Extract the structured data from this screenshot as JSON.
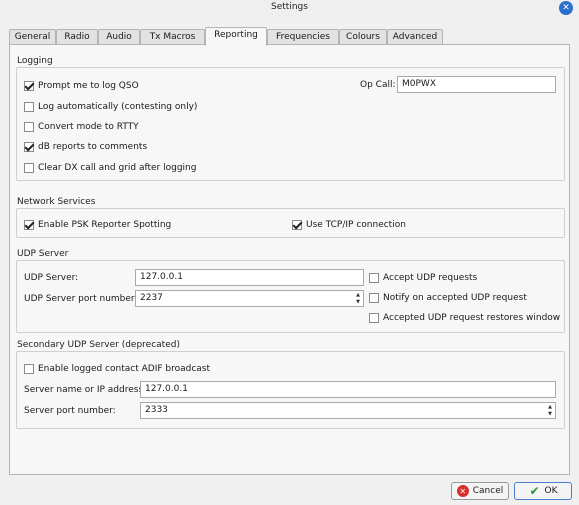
{
  "window": {
    "title": "Settings",
    "close_glyph": "✕"
  },
  "tabs": [
    "General",
    "Radio",
    "Audio",
    "Tx Macros",
    "Reporting",
    "Frequencies",
    "Colours",
    "Advanced"
  ],
  "active_tab": "Reporting",
  "logging": {
    "title": "Logging",
    "prompt_log_qso": {
      "label": "Prompt me to log QSO",
      "checked": true
    },
    "log_automatically": {
      "label": "Log automatically (contesting only)",
      "checked": false
    },
    "convert_rtty": {
      "label": "Convert mode to RTTY",
      "checked": false
    },
    "db_reports": {
      "label": "dB reports to comments",
      "checked": true
    },
    "clear_dx": {
      "label": "Clear DX call and grid after logging",
      "checked": false
    },
    "op_call_label": "Op Call:",
    "op_call_value": "M0PWX"
  },
  "network": {
    "title": "Network Services",
    "psk_spotting": {
      "label": "Enable PSK Reporter Spotting",
      "checked": true
    },
    "tcpip": {
      "label": "Use TCP/IP connection",
      "checked": true
    }
  },
  "udp": {
    "title": "UDP Server",
    "server_label": "UDP Server:",
    "server_value": "127.0.0.1",
    "port_label": "UDP Server port number:",
    "port_value": "2237",
    "accept_requests": {
      "label": "Accept UDP requests",
      "checked": false
    },
    "notify_accepted": {
      "label": "Notify on accepted UDP request",
      "checked": false
    },
    "restores_window": {
      "label": "Accepted UDP request restores window",
      "checked": false
    }
  },
  "secondary_udp": {
    "title": "Secondary UDP Server (deprecated)",
    "enable_adif": {
      "label": "Enable logged contact ADIF broadcast",
      "checked": false
    },
    "server_name_label": "Server name or IP address:",
    "server_name_value": "127.0.0.1",
    "port_label": "Server port number:",
    "port_value": "2333"
  },
  "buttons": {
    "cancel": "Cancel",
    "ok": "OK"
  },
  "colors": {
    "accent": "#2b6fcd",
    "cancel_icon": "#d9302c",
    "ok_icon": "#2f8c3a"
  }
}
